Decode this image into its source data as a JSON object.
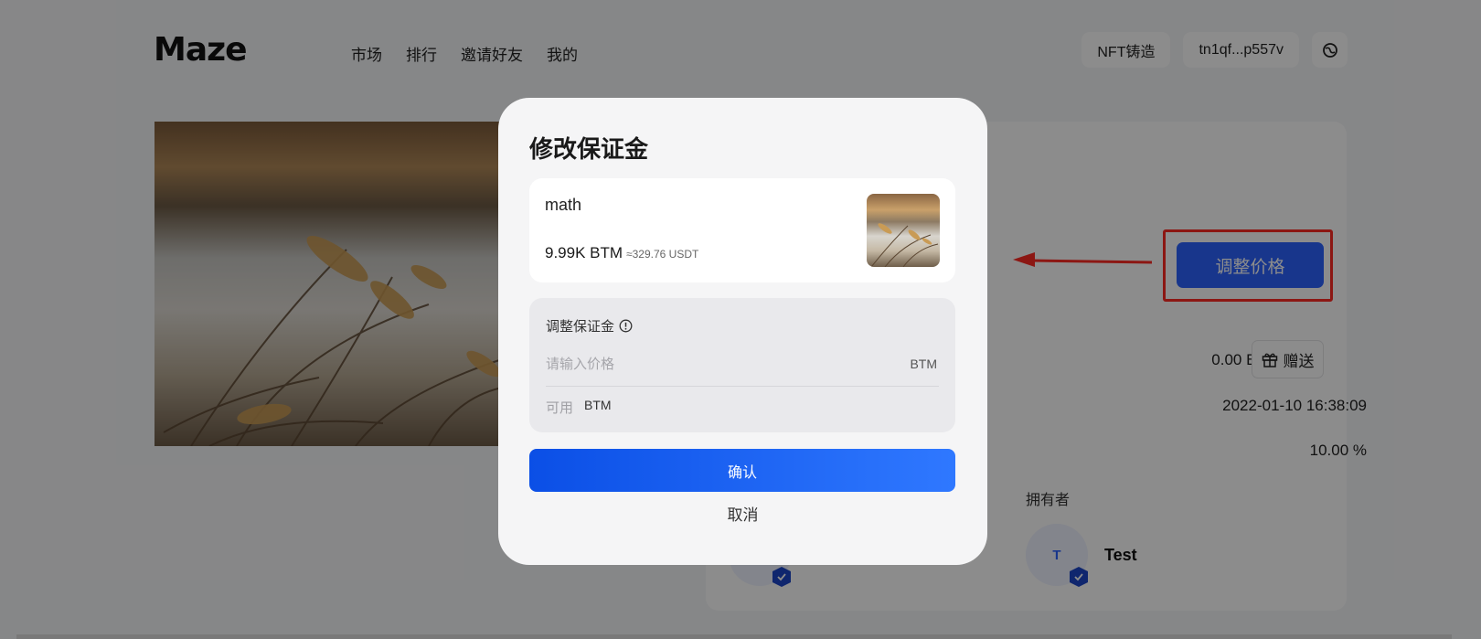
{
  "header": {
    "logo": "Maze",
    "nav": [
      "市场",
      "排行",
      "邀请好友",
      "我的"
    ],
    "mint_button": "NFT铸造",
    "wallet_address": "tn1qf...p557v",
    "settings_icon": "globe-icon"
  },
  "detail": {
    "adjust_price_button": "调整价格",
    "balance": "0.00 BTM",
    "gift_button": "赠送",
    "timestamp": "2022-01-10 16:38:09",
    "royalty": "10.00 %",
    "owner_label": "拥有者",
    "owner_avatar_letter": "T",
    "owner_name": "Test"
  },
  "modal": {
    "title": "修改保证金",
    "nft_name": "math",
    "nft_price": "9.99K BTM",
    "nft_price_usdt": "≈329.76 USDT",
    "margin_label": "调整保证金",
    "input_placeholder": "请输入价格",
    "input_unit": "BTM",
    "available_label": "可用",
    "available_value": "BTM",
    "confirm_button": "确认",
    "cancel_button": "取消"
  },
  "colors": {
    "accent": "#2c63ff",
    "highlight": "#ff2a24",
    "overlay": "rgba(0,0,0,0.45)"
  }
}
